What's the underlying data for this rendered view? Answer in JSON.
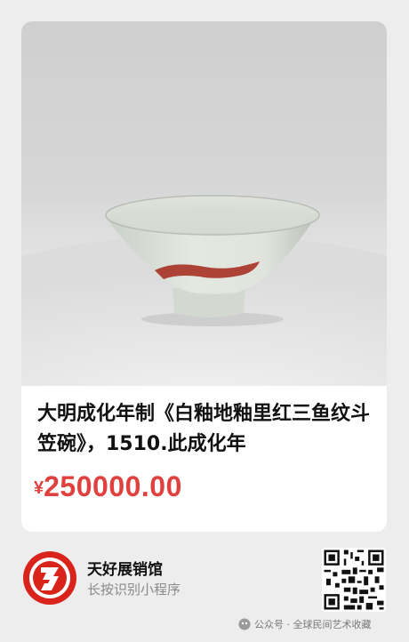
{
  "product": {
    "title": "大明成化年制《白釉地釉里红三鱼纹斗笠碗》，1510.此成化年",
    "currency_symbol": "¥",
    "price": "250000.00"
  },
  "shop": {
    "name": "天好展销馆",
    "subtitle": "长按识别小程序"
  },
  "watermark": {
    "text": "公众号 · 全球民间艺术收藏"
  },
  "colors": {
    "price": "#e0413e",
    "logo_red": "#d9241c"
  }
}
